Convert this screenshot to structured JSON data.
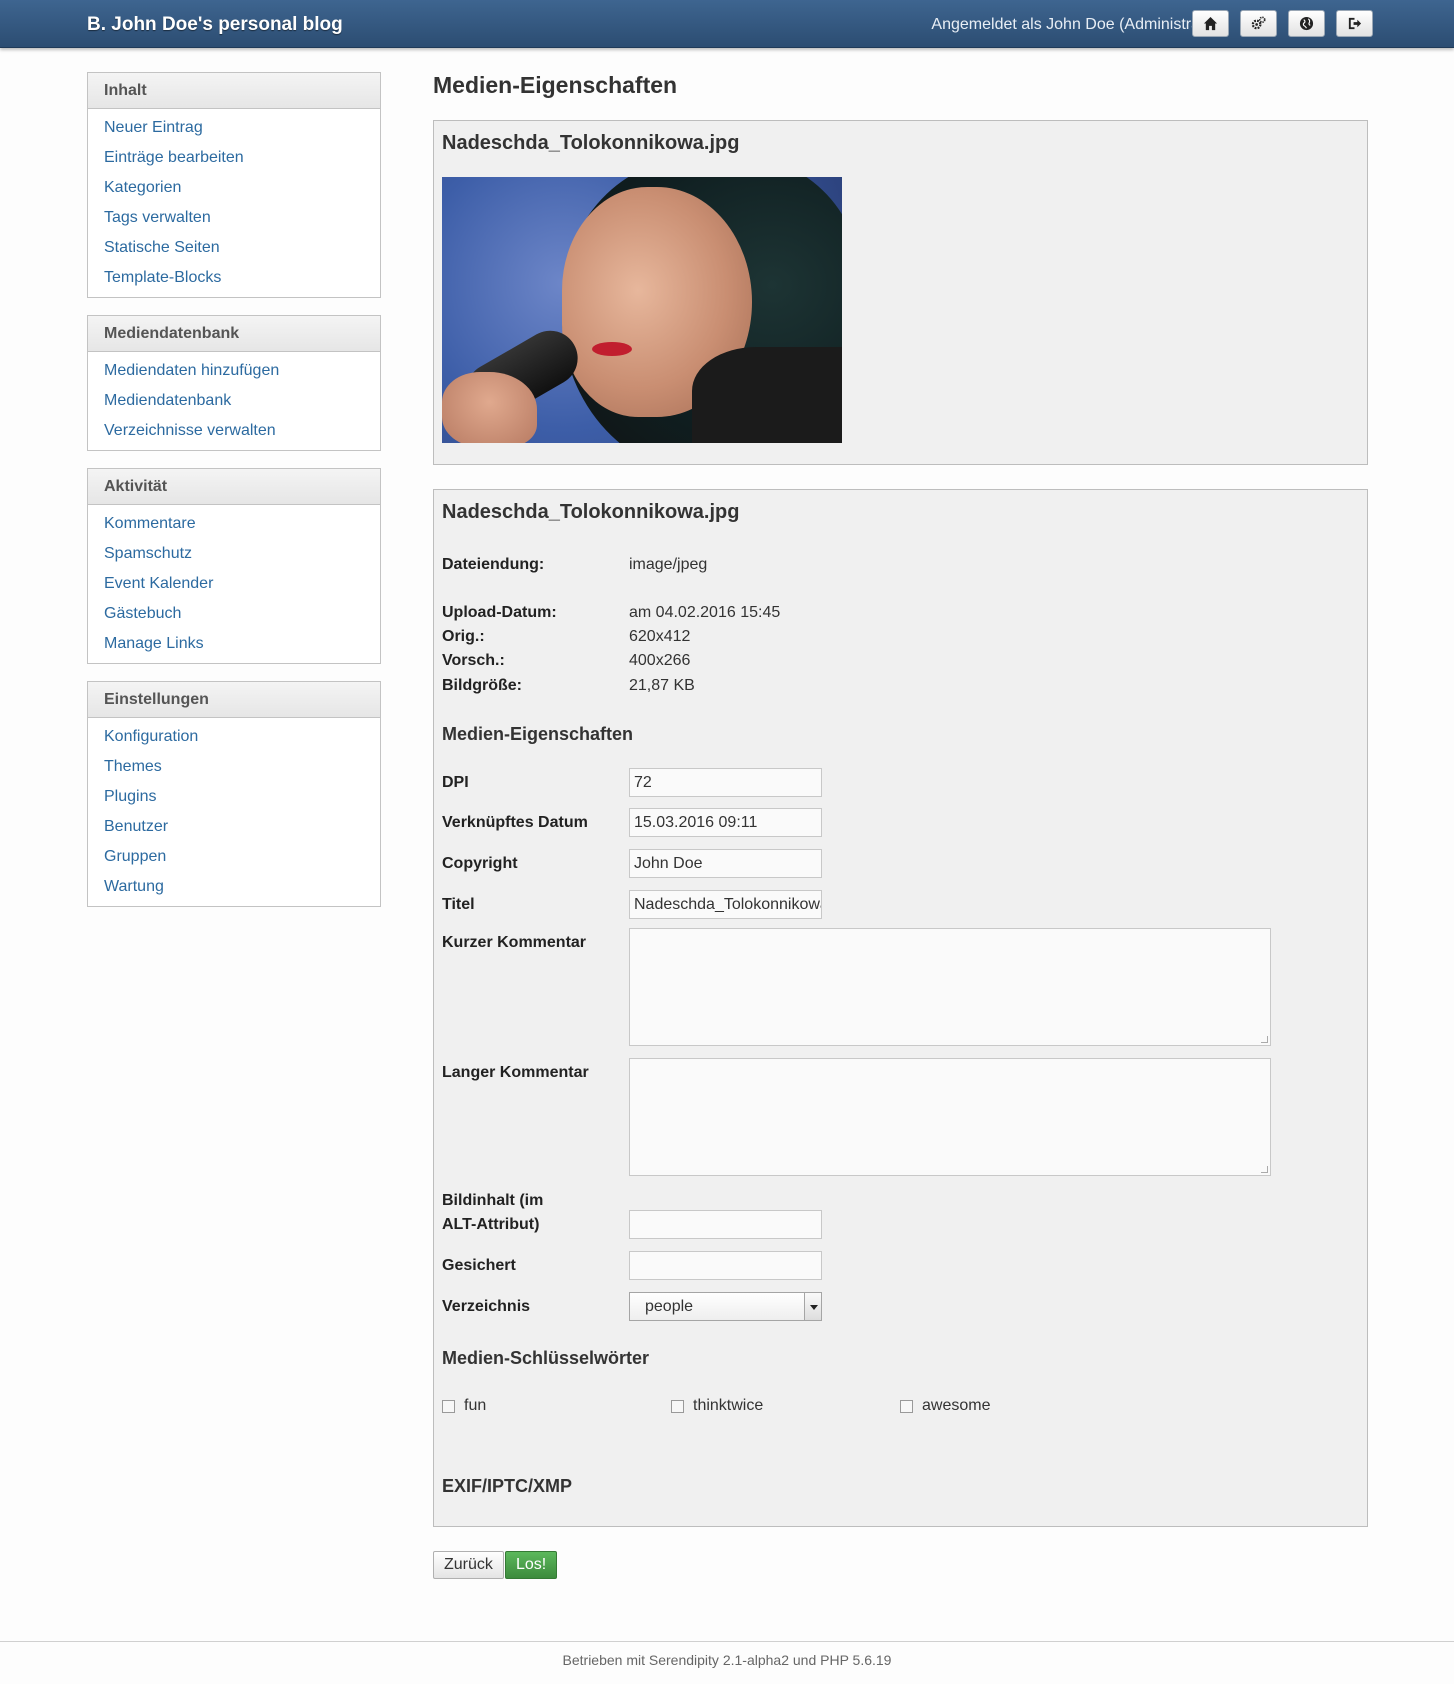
{
  "header": {
    "blog_title": "B. John Doe's personal blog",
    "login_info": "Angemeldet als John Doe (Administrator)",
    "buttons": [
      {
        "name": "home-icon"
      },
      {
        "name": "settings-icon"
      },
      {
        "name": "globe-icon"
      },
      {
        "name": "logout-icon"
      }
    ]
  },
  "sidebar": {
    "sections": [
      {
        "title": "Inhalt",
        "items": [
          "Neuer Eintrag",
          "Einträge bearbeiten",
          "Kategorien",
          "Tags verwalten",
          "Statische Seiten",
          "Template-Blocks"
        ]
      },
      {
        "title": "Mediendatenbank",
        "items": [
          "Mediendaten hinzufügen",
          "Mediendatenbank",
          "Verzeichnisse verwalten"
        ]
      },
      {
        "title": "Aktivität",
        "items": [
          "Kommentare",
          "Spamschutz",
          "Event Kalender",
          "Gästebuch",
          "Manage Links"
        ]
      },
      {
        "title": "Einstellungen",
        "items": [
          "Konfiguration",
          "Themes",
          "Plugins",
          "Benutzer",
          "Gruppen",
          "Wartung"
        ]
      }
    ]
  },
  "main": {
    "page_title": "Medien-Eigenschaften",
    "preview": {
      "filename": "Nadeschda_Tolokonnikowa.jpg"
    },
    "details": {
      "filename": "Nadeschda_Tolokonnikowa.jpg",
      "info": [
        {
          "label": "Dateiendung:",
          "value": "image/jpeg"
        },
        {
          "label": "Upload-Datum:",
          "value": "am 04.02.2016 15:45"
        },
        {
          "label": "Orig.:",
          "value": "620x412"
        },
        {
          "label": "Vorsch.:",
          "value": "400x266"
        },
        {
          "label": "Bildgröße:",
          "value": "21,87 KB"
        }
      ],
      "props_title": "Medien-Eigenschaften",
      "fields": {
        "dpi": {
          "label": "DPI",
          "value": "72"
        },
        "linked_date": {
          "label": "Verknüpftes Datum",
          "value": "15.03.2016 09:11"
        },
        "copyright": {
          "label": "Copyright",
          "value": "John Doe"
        },
        "title": {
          "label": "Titel",
          "value": "Nadeschda_Tolokonnikowa"
        },
        "short_comment": {
          "label": "Kurzer Kommentar",
          "value": ""
        },
        "long_comment": {
          "label": "Langer Kommentar",
          "value": ""
        },
        "alt_line1": "Bildinhalt (im",
        "alt_line2": "ALT-Attribut)",
        "alt_value": "",
        "secured": {
          "label": "Gesichert",
          "value": ""
        },
        "directory": {
          "label": "Verzeichnis",
          "value": "people"
        }
      },
      "keywords_title": "Medien-Schlüsselwörter",
      "keywords": [
        "fun",
        "thinktwice",
        "awesome"
      ],
      "exif_title": "EXIF/IPTC/XMP"
    },
    "back_label": "Zurück",
    "go_label": "Los!"
  },
  "footer": {
    "text": "Betrieben mit Serendipity 2.1-alpha2 und PHP 5.6.19"
  },
  "colors": {
    "header": "#2c4d72",
    "link": "#2c6aa0",
    "go_button": "#4cae4c"
  }
}
